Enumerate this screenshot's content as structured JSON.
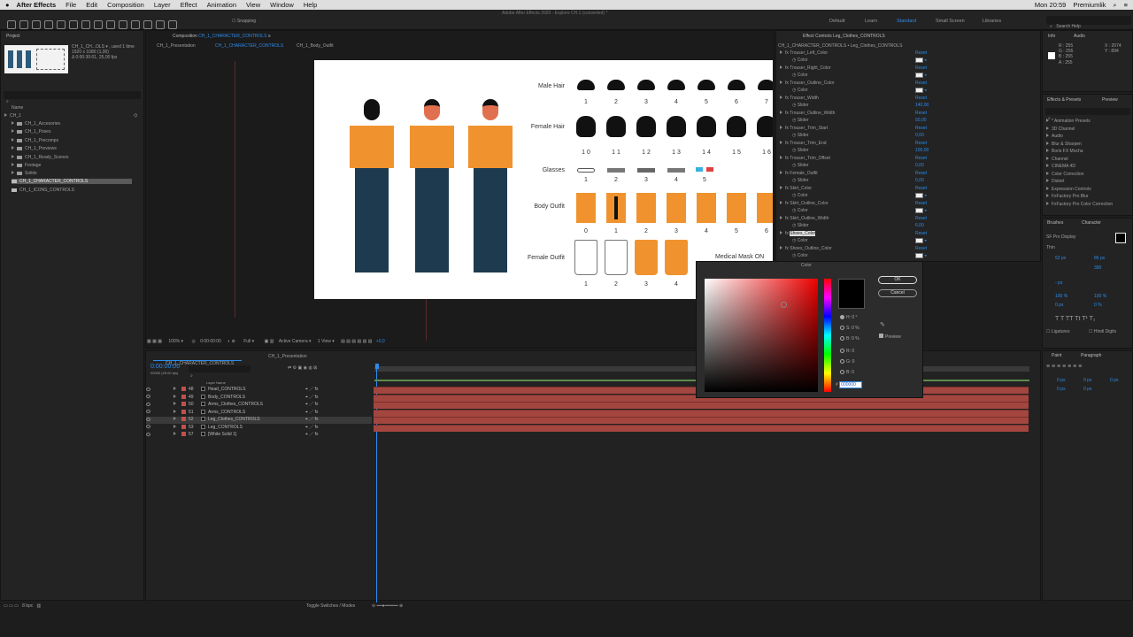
{
  "menubar": {
    "app_name": "After Effects",
    "items": [
      "File",
      "Edit",
      "Composition",
      "Layer",
      "Effect",
      "Animation",
      "View",
      "Window",
      "Help"
    ],
    "window_title": "Adobe After Effects 2020 - Explore CH.1 (converted) *",
    "clock": "Mon 20:59",
    "user": "Premiumlik"
  },
  "toolbar": {
    "snapping": "Snapping",
    "workspaces": [
      "Default",
      "Learn",
      "Standard",
      "Small Screen",
      "Libraries"
    ],
    "search_placeholder": "Search Help"
  },
  "project": {
    "tab": "Project",
    "item_name": "CH_1_CH...OLS ▾ , used 1 time",
    "item_size": "1920 x 1080 (1,00)",
    "item_duration": "Δ 0:00:30:01, 25,00 fps",
    "column": "Name",
    "root": "CH_1",
    "folders": [
      "CH_1_Accesories",
      "CH_1_Poses",
      "CH_1_Precomps",
      "CH_1_Previews",
      "CH_1_Ready_Scenes",
      "Footage",
      "Solids"
    ],
    "comps": [
      "CH_1_CHARACTER_CONTROLS",
      "CH_1_ICONS_CONTROLS"
    ],
    "bottom_bpc": "8 bpc"
  },
  "composition": {
    "tab_label": "Composition",
    "tab_comp": "CH_1_CHARACTER_CONTROLS",
    "breadcrumbs": [
      "CH_1_Presentation",
      "CH_1_CHARACTER_CONTROLS",
      "CH_1_Body_Outfit"
    ],
    "zoom": "100%",
    "timecode": "0:00:00:00",
    "resolution": "Full",
    "camera": "Active Camera",
    "views": "1 View",
    "exposure": "+0,0"
  },
  "canvas": {
    "row_labels": [
      "Male Hair",
      "Female Hair",
      "Glasses",
      "Body Outfit",
      "Female Outfit"
    ],
    "male_hair_numbers": [
      "1",
      "2",
      "3",
      "4",
      "5",
      "6",
      "7"
    ],
    "female_hair_numbers": [
      "1 0",
      "1 1",
      "1 2",
      "1 3",
      "1 4",
      "1 5",
      "1 6"
    ],
    "glasses_numbers": [
      "1",
      "2",
      "3",
      "4",
      "5"
    ],
    "body_numbers": [
      "0",
      "1",
      "2",
      "3",
      "4",
      "5",
      "6"
    ],
    "female_outfit_numbers": [
      "1",
      "2",
      "3",
      "4"
    ],
    "cut_label": "Medical Mask ON"
  },
  "effects": {
    "tab": "Effect Controls Leg_Clothes_CONTROLS",
    "header": "CH_1_CHARACTER_CONTROLS • Leg_Clothes_CONTROLS",
    "reset": "Reset",
    "rows": [
      {
        "name": "Trouser_Left_Color",
        "sub": "Color",
        "kind": "color"
      },
      {
        "name": "Trouser_Right_Color",
        "sub": "Color",
        "kind": "color"
      },
      {
        "name": "Trouser_Outline_Color",
        "sub": "Color",
        "kind": "color"
      },
      {
        "name": "Trouser_Width",
        "sub": "Slider",
        "value": "140,00"
      },
      {
        "name": "Trouser_Outline_Width",
        "sub": "Slider",
        "value": "50,00"
      },
      {
        "name": "Trouser_Trim_Start",
        "sub": "Slider",
        "value": "0,00"
      },
      {
        "name": "Trouser_Trim_End",
        "sub": "Slider",
        "value": "100,00"
      },
      {
        "name": "Trouser_Trim_Offset",
        "sub": "Slider",
        "value": "0,00"
      },
      {
        "name": "Female_Outfit",
        "sub": "Slider",
        "value": "0,00"
      },
      {
        "name": "Skirt_Color",
        "sub": "Color",
        "kind": "color"
      },
      {
        "name": "Skirt_Outline_Color",
        "sub": "Color",
        "kind": "color"
      },
      {
        "name": "Skirt_Outline_Width",
        "sub": "Slider",
        "value": "6,00"
      },
      {
        "name": "Shoes_Color",
        "sub": "Color",
        "kind": "color"
      },
      {
        "name": "Shoes_Outline_Color",
        "sub": "Color",
        "kind": "color"
      }
    ]
  },
  "info": {
    "tabs": [
      "Info",
      "Audio"
    ],
    "r": "R : 255",
    "g": "G : 255",
    "b": "B : 255",
    "a": "A : 255",
    "x": "X : 2074",
    "y": "Y : 894"
  },
  "presets": {
    "tabs": [
      "Effects & Presets",
      "Preview"
    ],
    "items": [
      "* Animation Presets",
      "3D Channel",
      "Audio",
      "Blur & Sharpen",
      "Boris FX Mocha",
      "Channel",
      "CINEMA 4D",
      "Color Correction",
      "Distort",
      "Expression Controls",
      "FxFactory Pro Blur",
      "FxFactory Pro Color Correction"
    ]
  },
  "character": {
    "tabs": [
      "Brushes",
      "Character"
    ],
    "font": "SF Pro Display",
    "style": "Thin",
    "size": "52 px",
    "leading": "86 px",
    "tracking": "390",
    "indent": "- px",
    "vscale": "100 %",
    "hscale": "100 %",
    "baseline": "0 px",
    "tsume": "0 %",
    "ligatures": "Ligatures",
    "hindi": "Hindi Digits"
  },
  "paragraph": {
    "tabs": [
      "Paint",
      "Paragraph"
    ],
    "values": [
      "0 px",
      "0 px",
      "0 px",
      "0 px",
      "0 px"
    ]
  },
  "timeline": {
    "tabs": [
      "CH_1_CHARACTER_CONTROLS",
      "CH_1_Presentation"
    ],
    "timecode": "0:00:00:00",
    "frames": "00000 (25.00 fps)",
    "column": "Layer Name",
    "layers": [
      {
        "num": "48",
        "name": "Head_CONTROLS"
      },
      {
        "num": "49",
        "name": "Body_CONTROLS"
      },
      {
        "num": "50",
        "name": "Arms_Clothes_CONTROLS"
      },
      {
        "num": "51",
        "name": "Arms_CONTROLS"
      },
      {
        "num": "52",
        "name": "Leg_Clothes_CONTROLS"
      },
      {
        "num": "53",
        "name": "Leg_CONTROLS"
      },
      {
        "num": "57",
        "name": "[White Solid 1]"
      }
    ],
    "toggle": "Toggle Switches / Modes"
  },
  "color_dialog": {
    "title": "Color",
    "ok": "OK",
    "cancel": "Cancel",
    "h": "H: 0 °",
    "s": "S: 0 %",
    "b_hsb": "B: 0 %",
    "r": "R: 0",
    "g": "G: 0",
    "b": "B: 0",
    "hex_prefix": "#",
    "hex": "000000",
    "preview": "Preview"
  },
  "colors": {
    "accent": "#2d8ceb",
    "track": "#a3463f",
    "shirt": "#f0932f",
    "trouser": "#1e3a4f"
  }
}
